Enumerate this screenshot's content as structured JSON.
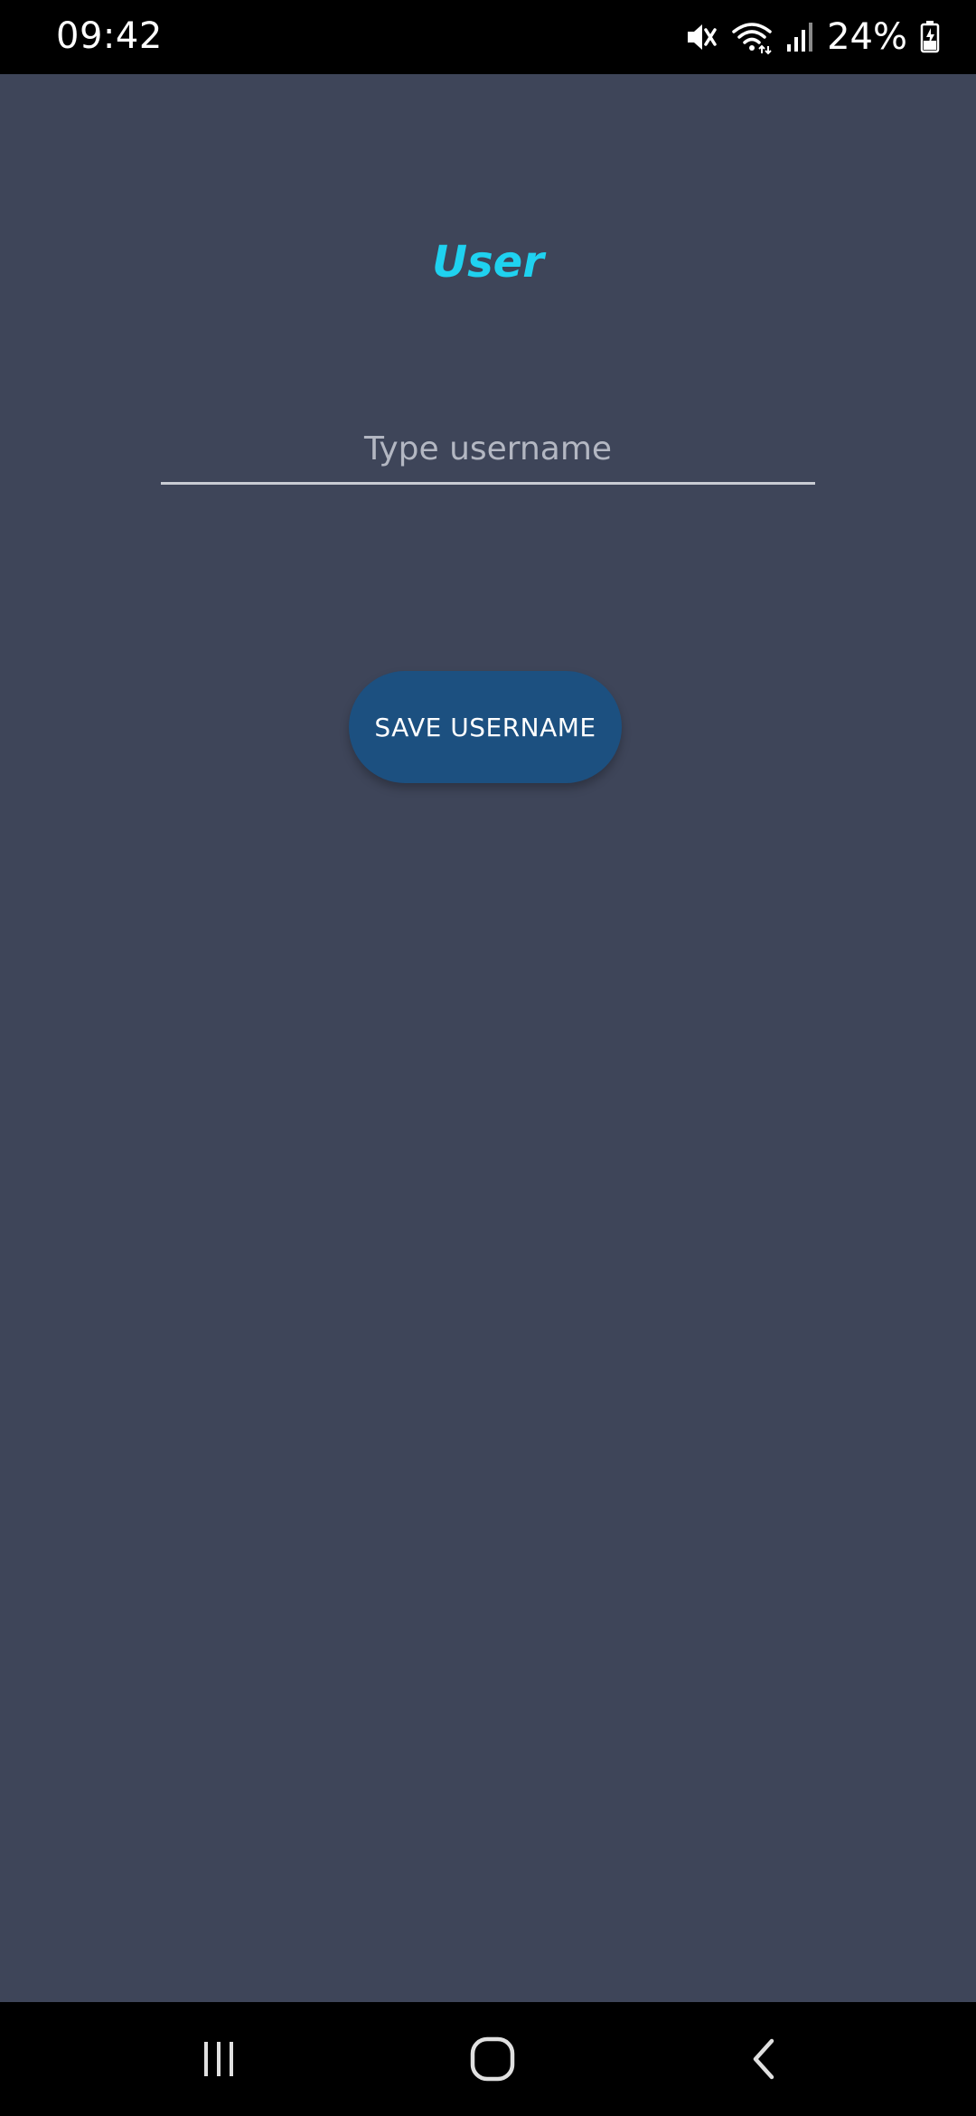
{
  "status_bar": {
    "time": "09:42",
    "battery_percent": "24%",
    "icons": [
      "mute-icon",
      "wifi-icon",
      "signal-icon",
      "battery-charging-icon"
    ]
  },
  "main": {
    "title": "User",
    "username_input": {
      "value": "",
      "placeholder": "Type username"
    },
    "save_button_label": "SAVE USERNAME"
  },
  "nav_bar": {
    "icons": [
      "recent-apps-icon",
      "home-icon",
      "back-icon"
    ]
  },
  "colors": {
    "background": "#3e4559",
    "title": "#1fd2f0",
    "button": "#1c5080",
    "bars": "#000000"
  }
}
